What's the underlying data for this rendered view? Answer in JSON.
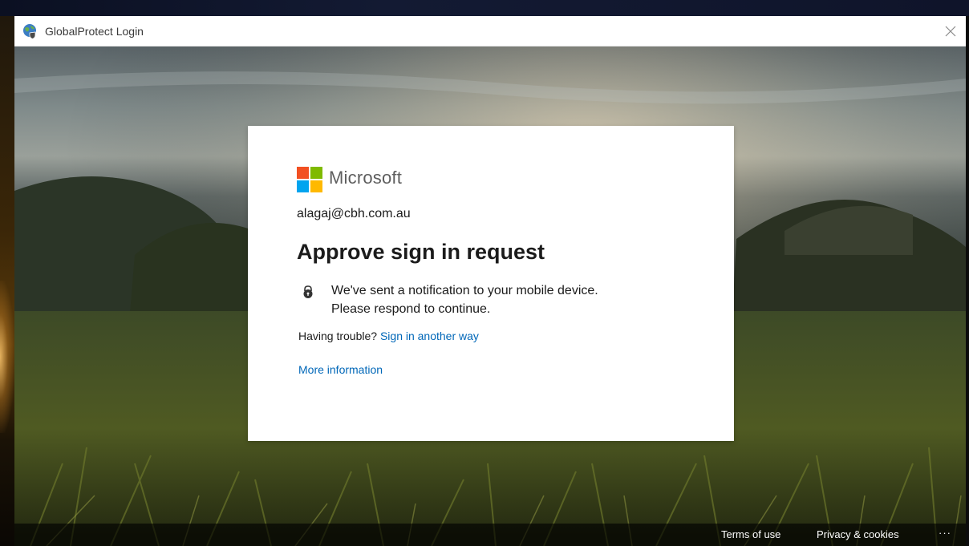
{
  "window": {
    "title": "GlobalProtect Login"
  },
  "signin": {
    "brand": "Microsoft",
    "identity": "alagaj@cbh.com.au",
    "heading": "Approve sign in request",
    "notice_line1": "We've sent a notification to your mobile device.",
    "notice_line2": "Please respond to continue.",
    "trouble_prefix": "Having trouble?",
    "trouble_link": "Sign in another way",
    "more_info": "More information"
  },
  "footer": {
    "terms": "Terms of use",
    "privacy": "Privacy & cookies",
    "more": "···"
  },
  "colors": {
    "link": "#0067b8",
    "text": "#1b1b1b",
    "ms_red": "#f25022",
    "ms_green": "#7fba00",
    "ms_blue": "#00a4ef",
    "ms_yellow": "#ffb900"
  },
  "icons": {
    "app": "globe-shield-icon",
    "close": "close-icon",
    "notice": "lock-icon"
  }
}
